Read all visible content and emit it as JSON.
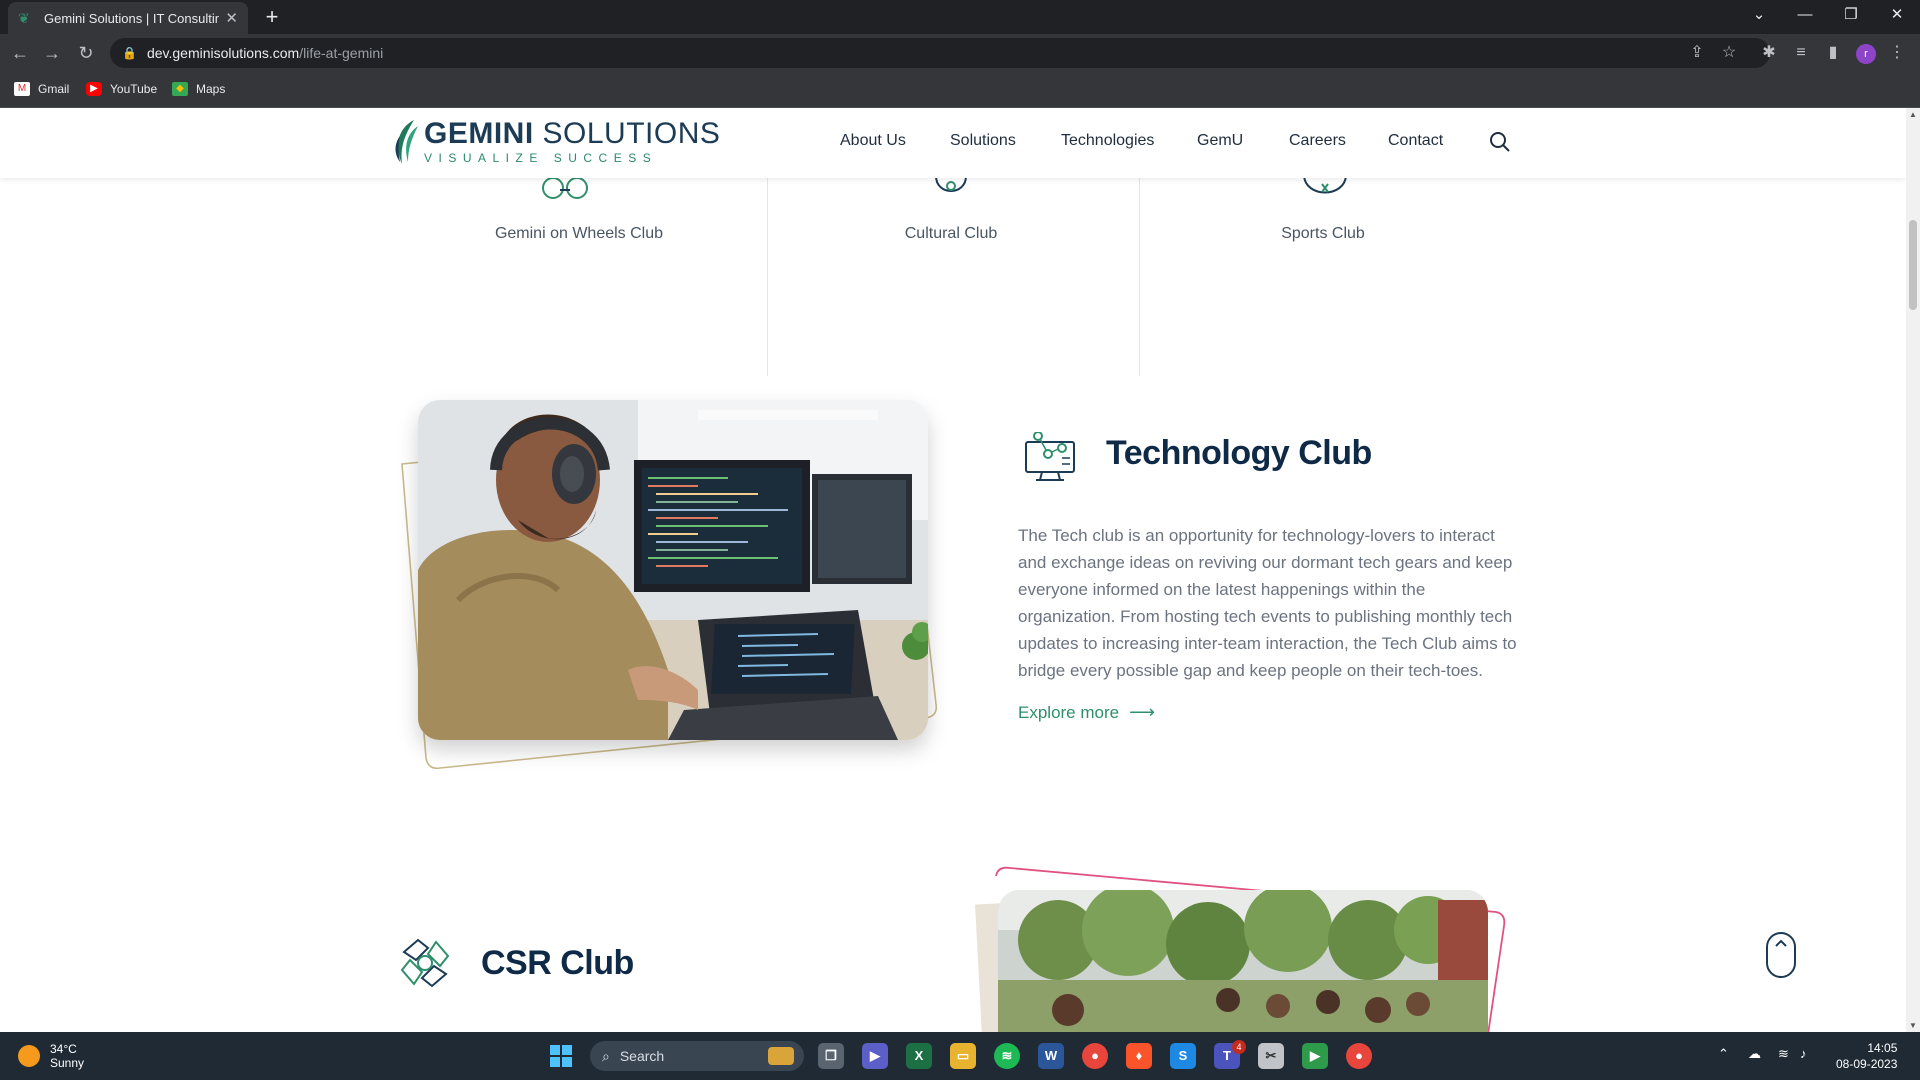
{
  "browser": {
    "tab_title": "Gemini Solutions | IT Consulting,",
    "url_host": "dev.geminisolutions.com",
    "url_path": "/life-at-gemini",
    "profile_initial": "r",
    "bookmarks": [
      {
        "label": "Gmail",
        "icon": "gmail-icon"
      },
      {
        "label": "YouTube",
        "icon": "youtube-icon"
      },
      {
        "label": "Maps",
        "icon": "maps-icon"
      }
    ]
  },
  "site": {
    "logo_name_bold": "GEMINI",
    "logo_name_rest": " SOLUTIONS",
    "logo_tagline": "VISUALIZE SUCCESS",
    "nav": [
      "About Us",
      "Solutions",
      "Technologies",
      "GemU",
      "Careers",
      "Contact"
    ]
  },
  "clubs_row": [
    "Gemini on Wheels Club",
    "Cultural Club",
    "Sports Club"
  ],
  "tech_club": {
    "title": "Technology Club",
    "description": "The Tech club is an opportunity for technology-lovers to interact and exchange ideas on reviving our dormant tech gears and keep everyone informed on the latest happenings within the organization. From hosting tech events to publishing monthly tech updates to increasing inter-team interaction, the Tech Club aims to bridge every possible gap and keep people on their tech-toes.",
    "cta": "Explore more"
  },
  "csr_club": {
    "title": "CSR Club"
  },
  "taskbar": {
    "temperature": "34°C",
    "weather": "Sunny",
    "search_placeholder": "Search",
    "time": "14:05",
    "date": "08-09-2023",
    "teams_badge": "4"
  },
  "colors": {
    "brand_navy": "#0e2a47",
    "brand_green": "#2f8f6b",
    "frame_gold": "#c9b98a",
    "frame_pink": "#e0527f"
  }
}
